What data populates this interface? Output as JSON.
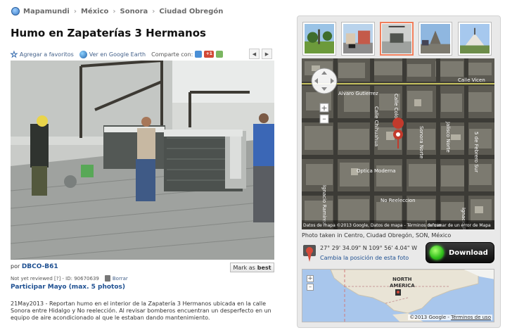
{
  "breadcrumb": [
    "Mapamundi",
    "México",
    "Sonora",
    "Ciudad Obregón"
  ],
  "page_title": "Humo en Zapaterías 3 Hermanos",
  "actions": {
    "favorites": "Agregar a favoritos",
    "google_earth": "Ver en Google Earth",
    "share": "Comparte con:",
    "share_gplus": "+1"
  },
  "author": {
    "prefix": "por",
    "name": "DBCO-B61",
    "mark_as": "Mark as",
    "best": "best",
    "review_status": "Not yet reviewed [?] - ID: 90670639",
    "delete": "Borrar",
    "participate": "Participar Mayo (max. 5 photos)"
  },
  "description": "21May2013 - Reportan humo en el interior de la Zapatería 3 Hermanos ubicada en la calle Sonora entre Hidalgo y No reelección. Al revisar bomberos encuentran un desperfecto en un equipo de aire acondicionado al que le estaban dando mantenimiento.",
  "sat_map": {
    "labels": [
      "Calle Vicen",
      "Alvaro Gutierrez",
      "Calle Chihuahua",
      "Calle Colon",
      "Sonora Norte",
      "Jalisco Norte",
      "Ignacio Ramirez",
      "5 de Febrero Sur",
      "Optica Moderna",
      "No Reeleccion",
      "Ignacio Ramirez"
    ],
    "report_error": "Informar de un error de Mapa",
    "terms": "Datos de mapa ©2013 Google, Datos de mapa - Términos de uso"
  },
  "photo_location": "Photo taken in Centro, Ciudad Obregón, SON, México",
  "coordinates": "27° 29' 34.09\" N  109° 56' 4.04\" W",
  "change_position": "Cambia la posición de esta foto",
  "download_label": "Download",
  "world_map": {
    "label_north": "NORTH",
    "label_america": "AMERICA",
    "copyright": "©2013 Google -",
    "terms": "Términos de uso"
  },
  "colors": {
    "link": "#1d4f91",
    "highlight_thumb": "#f07d5a",
    "download_green": "#2fbf1a",
    "panel_bg": "#e9e9e9"
  }
}
